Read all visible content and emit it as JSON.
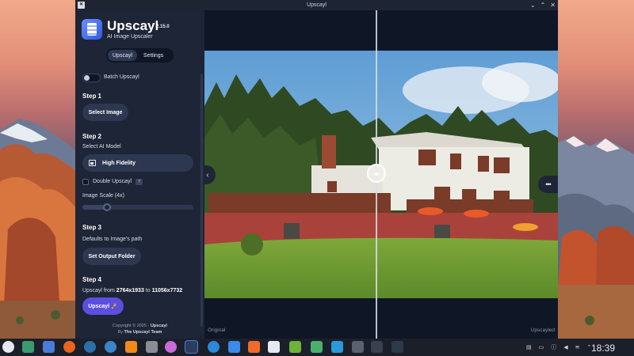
{
  "window": {
    "title": "Upscayl",
    "controls": [
      "⌄",
      "⌃",
      "✕"
    ]
  },
  "sidebar": {
    "app_name": "Upscayl",
    "version": "2.15.0",
    "subtitle": "AI Image Upscaler",
    "tabs": [
      {
        "label": "Upscayl",
        "active": true
      },
      {
        "label": "Settings",
        "active": false
      }
    ],
    "batch_label": "Batch Upscayl",
    "batch_enabled": false,
    "step1": {
      "title": "Step 1",
      "button": "Select Image"
    },
    "step2": {
      "title": "Step 2",
      "model_label": "Select AI Model",
      "model_value": "High Fidelity",
      "double_label": "Double Upscayl",
      "double_help": "?",
      "double_checked": false,
      "scale_label": "Image Scale (4x)",
      "scale_value": 4,
      "scale_fraction": 0.22
    },
    "step3": {
      "title": "Step 3",
      "desc": "Defaults to Image's path",
      "button": "Set Output Folder"
    },
    "step4": {
      "title": "Step 4",
      "prefix": "Upscayl from",
      "from": "2764x1933",
      "mid": "to",
      "to": "11056x7732",
      "button": "Upscayl 🚀"
    },
    "footer": {
      "line1_prefix": "Copyright © 2025 -",
      "line1_name": "Upscayl",
      "line2_prefix": "By",
      "line2_name": "The Upscayl Team"
    }
  },
  "main": {
    "label_left": "Original",
    "label_right": "Upscayled",
    "divider_icon": "◂▸",
    "collapse_icon": "‹",
    "more_icon": "•••",
    "split_fraction": 0.485
  },
  "taskbar": {
    "clock": "18:39",
    "icons": [
      "start-icon",
      "desktop-icon",
      "file-manager-icon",
      "firefox-icon",
      "steam-icon",
      "steam-alt-icon",
      "vlc-icon",
      "media-icon",
      "obs-icon",
      "upscayl-icon",
      "network-icon",
      "doc-icon",
      "office-icon",
      "chart-icon",
      "nvidia-icon",
      "photo-icon",
      "store-icon",
      "display-icon",
      "terminal-icon",
      "console-icon"
    ],
    "tray_icons": [
      "clipboard-icon",
      "monitor-icon",
      "info-icon",
      "speaker-icon",
      "wifi-icon",
      "tray-arrow-icon"
    ]
  },
  "colors": {
    "accent": "#5b4fe0",
    "sidebar": "#1d2536",
    "surface": "#2d3850",
    "bg": "#0f1626"
  }
}
